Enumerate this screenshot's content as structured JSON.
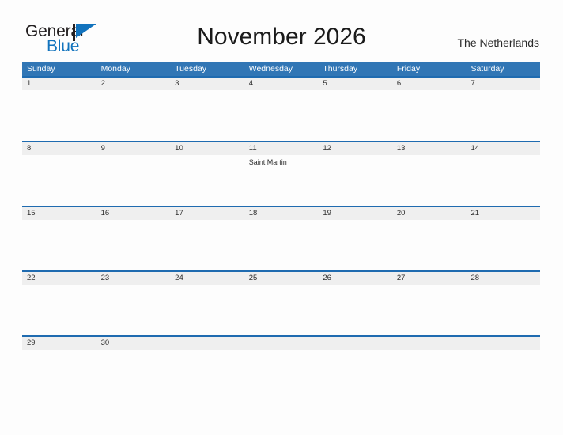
{
  "brand": {
    "name_part1": "General",
    "name_part2": "Blue",
    "flag_icon": "blue-flag-triangle-icon",
    "dark_color": "#231f20",
    "blue_color": "#1273bd"
  },
  "header": {
    "title": "November 2026",
    "subtitle": "The Netherlands"
  },
  "theme": {
    "header_blue": "#3176b5",
    "band_gray": "#efefef",
    "rule_blue": "#1f6bb0",
    "page_background": "#fdfdfd",
    "text_color": "#2e2e2e"
  },
  "weekdays": [
    "Sunday",
    "Monday",
    "Tuesday",
    "Wednesday",
    "Thursday",
    "Friday",
    "Saturday"
  ],
  "weeks": [
    {
      "dates": [
        "1",
        "2",
        "3",
        "4",
        "5",
        "6",
        "7"
      ],
      "events": [
        [],
        [],
        [],
        [],
        [],
        [],
        []
      ]
    },
    {
      "dates": [
        "8",
        "9",
        "10",
        "11",
        "12",
        "13",
        "14"
      ],
      "events": [
        [],
        [],
        [],
        [
          "Saint Martin"
        ],
        [],
        [],
        []
      ]
    },
    {
      "dates": [
        "15",
        "16",
        "17",
        "18",
        "19",
        "20",
        "21"
      ],
      "events": [
        [],
        [],
        [],
        [],
        [],
        [],
        []
      ]
    },
    {
      "dates": [
        "22",
        "23",
        "24",
        "25",
        "26",
        "27",
        "28"
      ],
      "events": [
        [],
        [],
        [],
        [],
        [],
        [],
        []
      ]
    },
    {
      "dates": [
        "29",
        "30",
        "",
        "",
        "",
        "",
        ""
      ],
      "events": [
        [],
        [],
        [],
        [],
        [],
        [],
        []
      ]
    }
  ]
}
